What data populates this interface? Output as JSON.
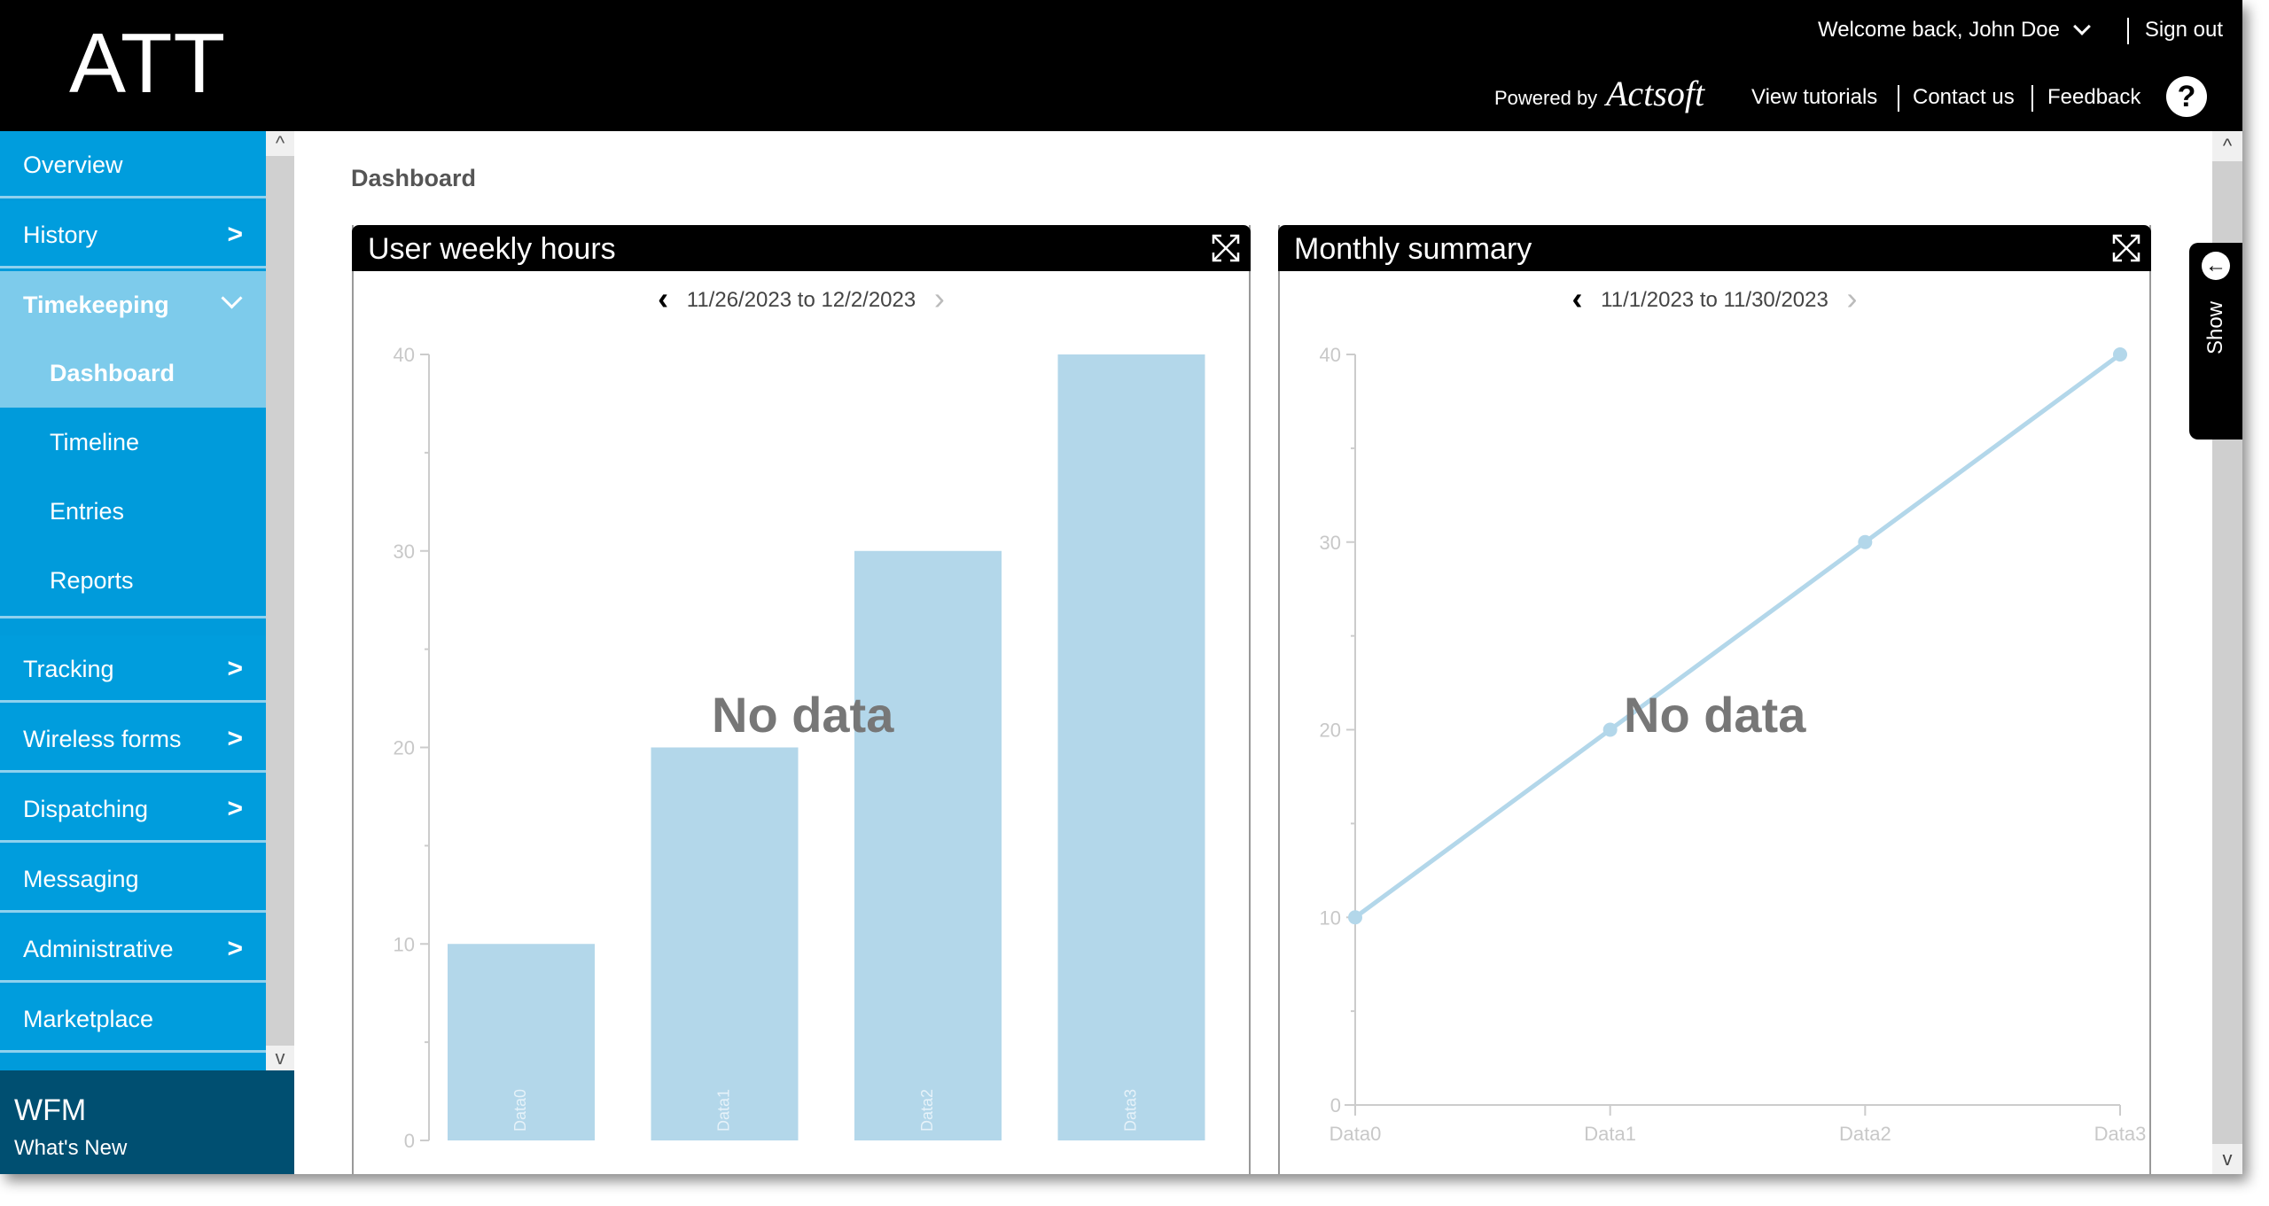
{
  "header": {
    "logo": "ATT",
    "welcome": "Welcome back, John Doe",
    "sign_out": "Sign out",
    "powered_by": "Powered by",
    "powered_brand": "Actsoft",
    "links": [
      "View tutorials",
      "Contact us",
      "Feedback"
    ],
    "help_icon": "?"
  },
  "sidebar": {
    "items": [
      {
        "label": "Overview",
        "has_children": false
      },
      {
        "label": "History",
        "has_children": true
      },
      {
        "label": "Timekeeping",
        "has_children": true,
        "expanded": true
      },
      {
        "label": "Tracking",
        "has_children": true
      },
      {
        "label": "Wireless forms",
        "has_children": true
      },
      {
        "label": "Dispatching",
        "has_children": true
      },
      {
        "label": "Messaging",
        "has_children": false
      },
      {
        "label": "Administrative",
        "has_children": true
      },
      {
        "label": "Marketplace",
        "has_children": false
      }
    ],
    "sub_items": [
      {
        "label": "Dashboard",
        "active": true
      },
      {
        "label": "Timeline"
      },
      {
        "label": "Entries"
      },
      {
        "label": "Reports"
      }
    ],
    "arrow_glyph": ">",
    "scroll_up": "^",
    "scroll_down": "v",
    "footer": {
      "title": "WFM",
      "subtitle": "What's New"
    }
  },
  "main": {
    "page_title": "Dashboard",
    "show_tab": {
      "label": "Show",
      "icon": "←"
    },
    "scroll_up": "^",
    "scroll_down": "v",
    "colors": {
      "accent": "#009ddd",
      "accent_light": "#7dcbeb",
      "footer": "#004f71",
      "series": "#b3d7ea"
    }
  },
  "panels": [
    {
      "title": "User weekly hours",
      "range": "11/26/2023 to 12/2/2023",
      "prev": "‹",
      "next": "›",
      "overlay": "No data"
    },
    {
      "title": "Monthly summary",
      "range": "11/1/2023 to 11/30/2023",
      "prev": "‹",
      "next": "›",
      "overlay": "No data"
    }
  ],
  "chart_data": [
    {
      "type": "bar",
      "title": "User weekly hours",
      "categories": [
        "Data0",
        "Data1",
        "Data2",
        "Data3"
      ],
      "values": [
        10,
        20,
        30,
        40
      ],
      "ylim": [
        0,
        40
      ],
      "yticks": [
        0,
        10,
        20,
        30,
        40
      ],
      "xlabel": "",
      "ylabel": "",
      "grid": false,
      "category_labels_inside_bars": true,
      "overlay": "No data"
    },
    {
      "type": "line",
      "title": "Monthly summary",
      "categories": [
        "Data0",
        "Data1",
        "Data2",
        "Data3"
      ],
      "values": [
        10,
        20,
        30,
        40
      ],
      "ylim": [
        0,
        40
      ],
      "yticks": [
        0,
        10,
        20,
        30,
        40
      ],
      "xlabel": "",
      "ylabel": "",
      "grid": false,
      "overlay": "No data"
    }
  ]
}
